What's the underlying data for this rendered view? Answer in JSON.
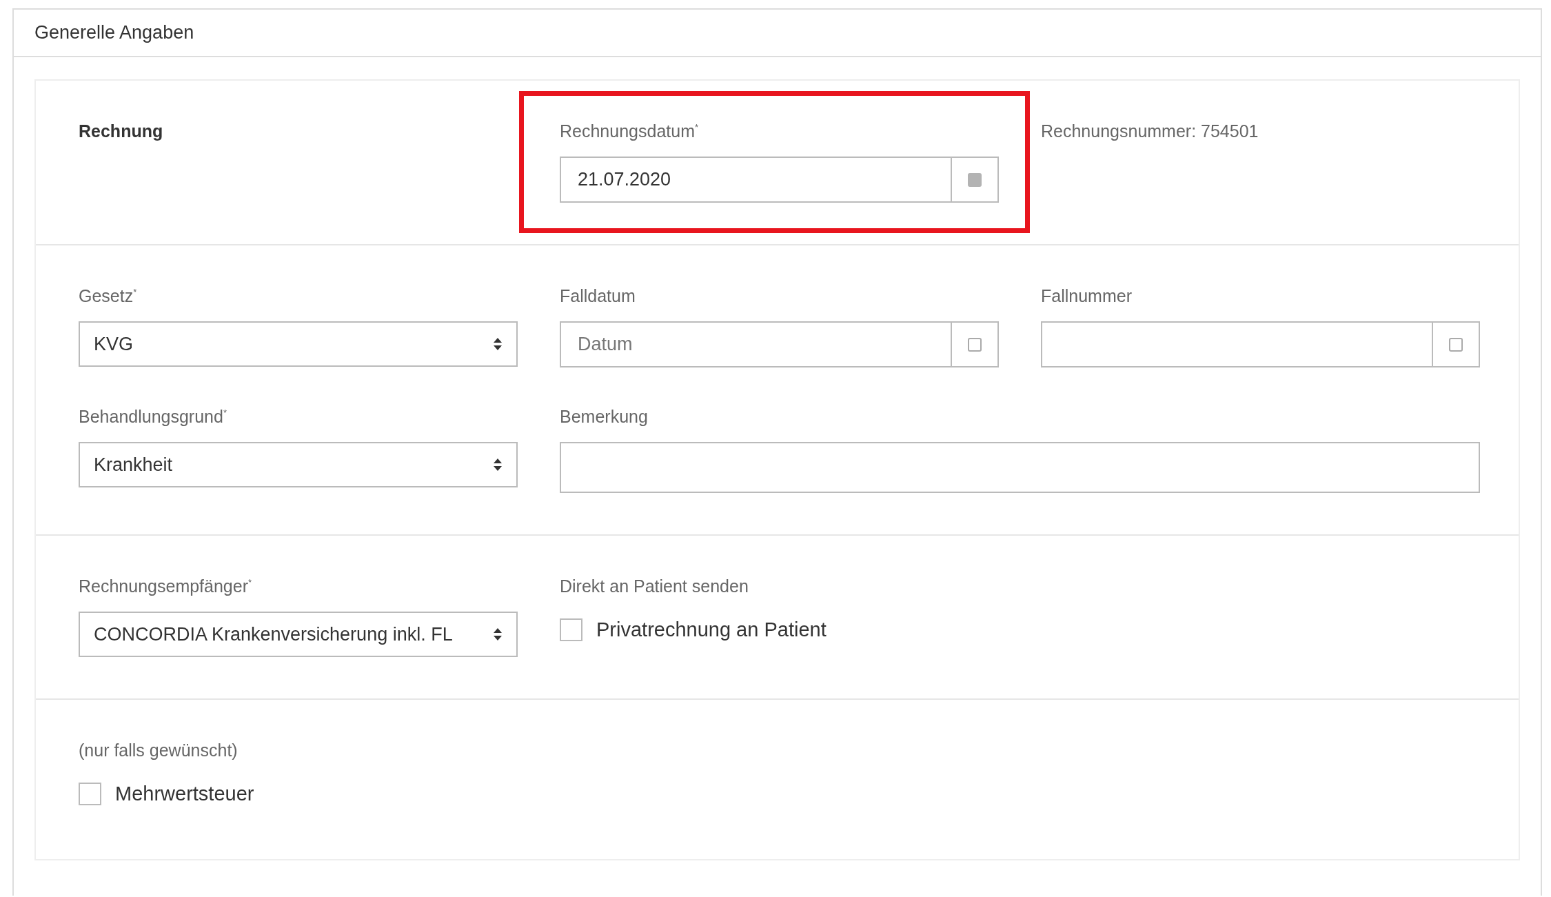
{
  "panel": {
    "title": "Generelle Angaben"
  },
  "sections": [
    {
      "cells": [
        {
          "kind": "heading",
          "text": "Rechnung"
        },
        {
          "kind": "addon",
          "label": "Rechnungsdatum$^{*}$",
          "value": "21.07.2020",
          "highlighted": true,
          "addon_active": true
        },
        {
          "kind": "info",
          "text": "Rechnungsnummer: 754501"
        }
      ]
    },
    {
      "cells": [
        {
          "kind": "select",
          "label": "Gesetz$^{*}$",
          "value": "KVG"
        },
        {
          "kind": "addon",
          "label": "Falldatum",
          "placeholder": "Datum",
          "addon_active": false
        },
        {
          "kind": "addon",
          "label": "Fallnummer",
          "addon_active": false
        },
        {
          "kind": "select",
          "label": "Behandlungsgrund$^{*}$",
          "value": "Krankheit"
        },
        {
          "kind": "text",
          "label": "Bemerkung"
        }
      ]
    },
    {
      "cells": [
        {
          "kind": "select",
          "label": "Rechnungsempfänger$^{*}$",
          "value": "CONCORDIA Krankenversicherung inkl. FL"
        },
        {
          "kind": "checkbox",
          "label": "Direkt an Patient senden",
          "option": "Privatrechnung an Patient",
          "checked": false
        }
      ]
    },
    {
      "cells": [
        {
          "kind": "checkbox",
          "label": "(nur falls gewünscht)",
          "option": "Mehrwertsteuer",
          "checked": false
        }
      ]
    }
  ]
}
